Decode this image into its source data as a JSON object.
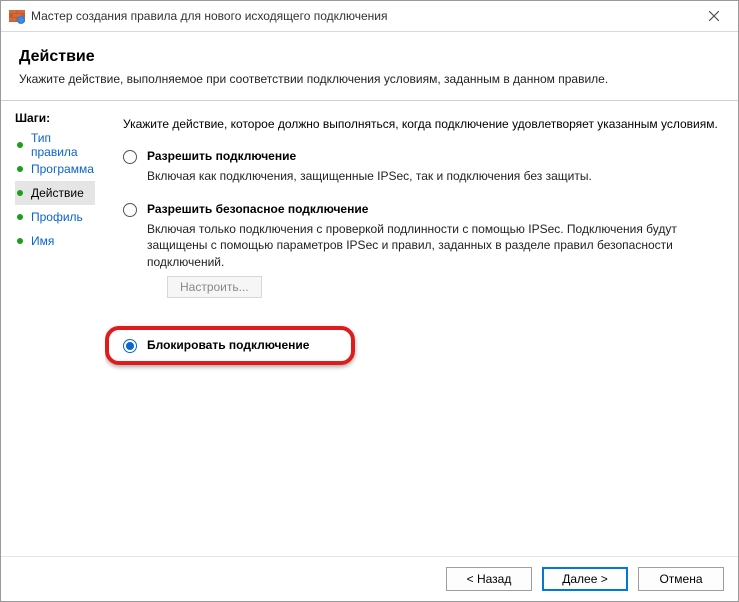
{
  "window": {
    "title": "Мастер создания правила для нового исходящего подключения"
  },
  "header": {
    "title": "Действие",
    "subtitle": "Укажите действие, выполняемое при соответствии подключения условиям, заданным в данном правиле."
  },
  "sidebar": {
    "steps_label": "Шаги:",
    "steps": [
      {
        "label": "Тип правила"
      },
      {
        "label": "Программа"
      },
      {
        "label": "Действие"
      },
      {
        "label": "Профиль"
      },
      {
        "label": "Имя"
      }
    ]
  },
  "content": {
    "intro": "Укажите действие, которое должно выполняться, когда подключение удовлетворяет указанным условиям.",
    "options": {
      "allow": {
        "title": "Разрешить подключение",
        "desc": "Включая как подключения, защищенные IPSec, так и подключения без защиты."
      },
      "allow_secure": {
        "title": "Разрешить безопасное подключение",
        "desc": "Включая только подключения с проверкой подлинности с помощью IPSec. Подключения будут защищены с помощью параметров IPSec и правил, заданных в разделе правил безопасности подключений."
      },
      "configure_label": "Настроить...",
      "block": {
        "title": "Блокировать подключение"
      }
    }
  },
  "footer": {
    "back": "< Назад",
    "next": "Далее >",
    "cancel": "Отмена"
  }
}
